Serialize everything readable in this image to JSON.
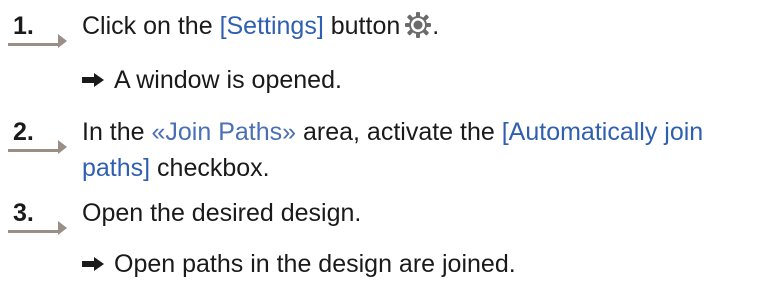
{
  "steps": [
    {
      "number": "1.",
      "before": "Click on the ",
      "ui_label": "[Settings]",
      "after": " button",
      "icon": "gear-icon",
      "end": "."
    },
    {
      "number": "2.",
      "before": "In the ",
      "area": "«Join Paths»",
      "middle": " area, activate the ",
      "ui_label": "[Automatically join paths]",
      "after": " checkbox."
    },
    {
      "number": "3.",
      "text": "Open the desired design."
    }
  ],
  "results": [
    {
      "text": "A window is opened."
    },
    {
      "text": "Open paths in the design are joined."
    }
  ],
  "colors": {
    "ui_label": "#2f5fb0",
    "area_label": "#4a6fb5",
    "marker": "#9a8f86",
    "text": "#1a1a1a"
  }
}
